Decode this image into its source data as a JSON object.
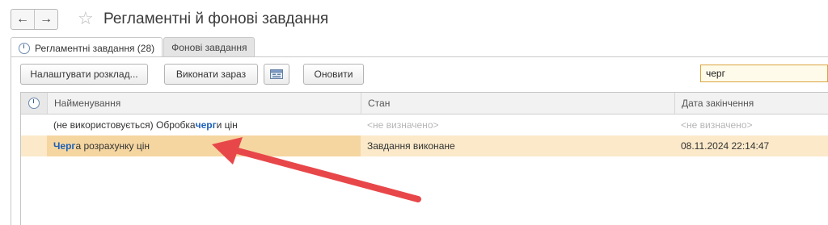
{
  "window": {
    "title": "Регламентні й фонові завдання",
    "back_icon": "arrow-left-icon",
    "forward_icon": "arrow-right-icon",
    "favorite_icon": "star-icon"
  },
  "tabs": [
    {
      "label": "Регламентні завдання (28)",
      "active": true
    },
    {
      "label": "Фонові завдання",
      "active": false
    }
  ],
  "toolbar": {
    "configure_schedule": "Налаштувати розклад...",
    "run_now": "Виконати зараз",
    "dialog_icon": "window-settings-icon",
    "refresh": "Оновити",
    "search_value": "черг"
  },
  "table": {
    "columns": [
      "Найменування",
      "Стан",
      "Дата закінчення"
    ],
    "rows": [
      {
        "name_prefix": "(не використовується) Обробка ",
        "name_match": "черг",
        "name_suffix": "и цін",
        "state": "<не визначено>",
        "end_date": "<не визначено>",
        "selected": false
      },
      {
        "name_prefix": "",
        "name_match": "Черг",
        "name_suffix": "а розрахунку цін",
        "state": "Завдання виконане",
        "end_date": "08.11.2024 22:14:47",
        "selected": true
      }
    ]
  },
  "annotation": {
    "type": "red-arrow",
    "color": "#e8474a",
    "points_to": "Черга розрахунку цін"
  },
  "colors": {
    "highlight_text": "#1d5fb8",
    "selected_row": "#fbe9c9",
    "search_border": "#d9a33f"
  }
}
